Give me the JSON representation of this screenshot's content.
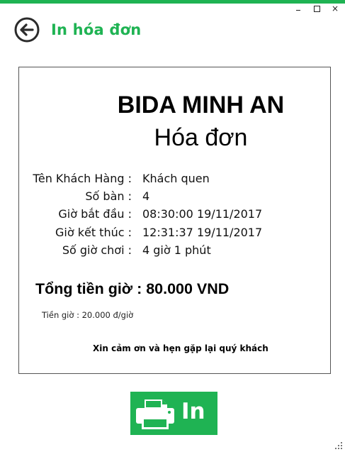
{
  "window": {
    "title": "In hóa đơn",
    "accent_color": "#1fb353",
    "controls": {
      "minimize_icon": "minimize-icon",
      "maximize_icon": "maximize-icon",
      "close_label": "×"
    }
  },
  "header": {
    "back_icon": "back-arrow-icon",
    "title": "In hóa đơn"
  },
  "receipt": {
    "shop_name": "BIDA MINH AN",
    "doc_title": "Hóa đơn",
    "fields": [
      {
        "label": "Tên Khách Hàng :",
        "value": "Khách quen"
      },
      {
        "label": "Số bàn :",
        "value": "4"
      },
      {
        "label": "Giờ bắt đầu :",
        "value": "08:30:00 19/11/2017"
      },
      {
        "label": "Giờ kết thúc :",
        "value": "12:31:37 19/11/2017"
      },
      {
        "label": "Số giờ chơi :",
        "value": "4 giờ 1 phút"
      }
    ],
    "total": "Tổng tiền giờ : 80.000 VND",
    "rate": "Tiền giờ : 20.000 đ/giờ",
    "thanks": "Xin cảm ơn và hẹn gặp lại quý khách"
  },
  "print_button": {
    "icon": "printer-icon",
    "label": "In"
  }
}
